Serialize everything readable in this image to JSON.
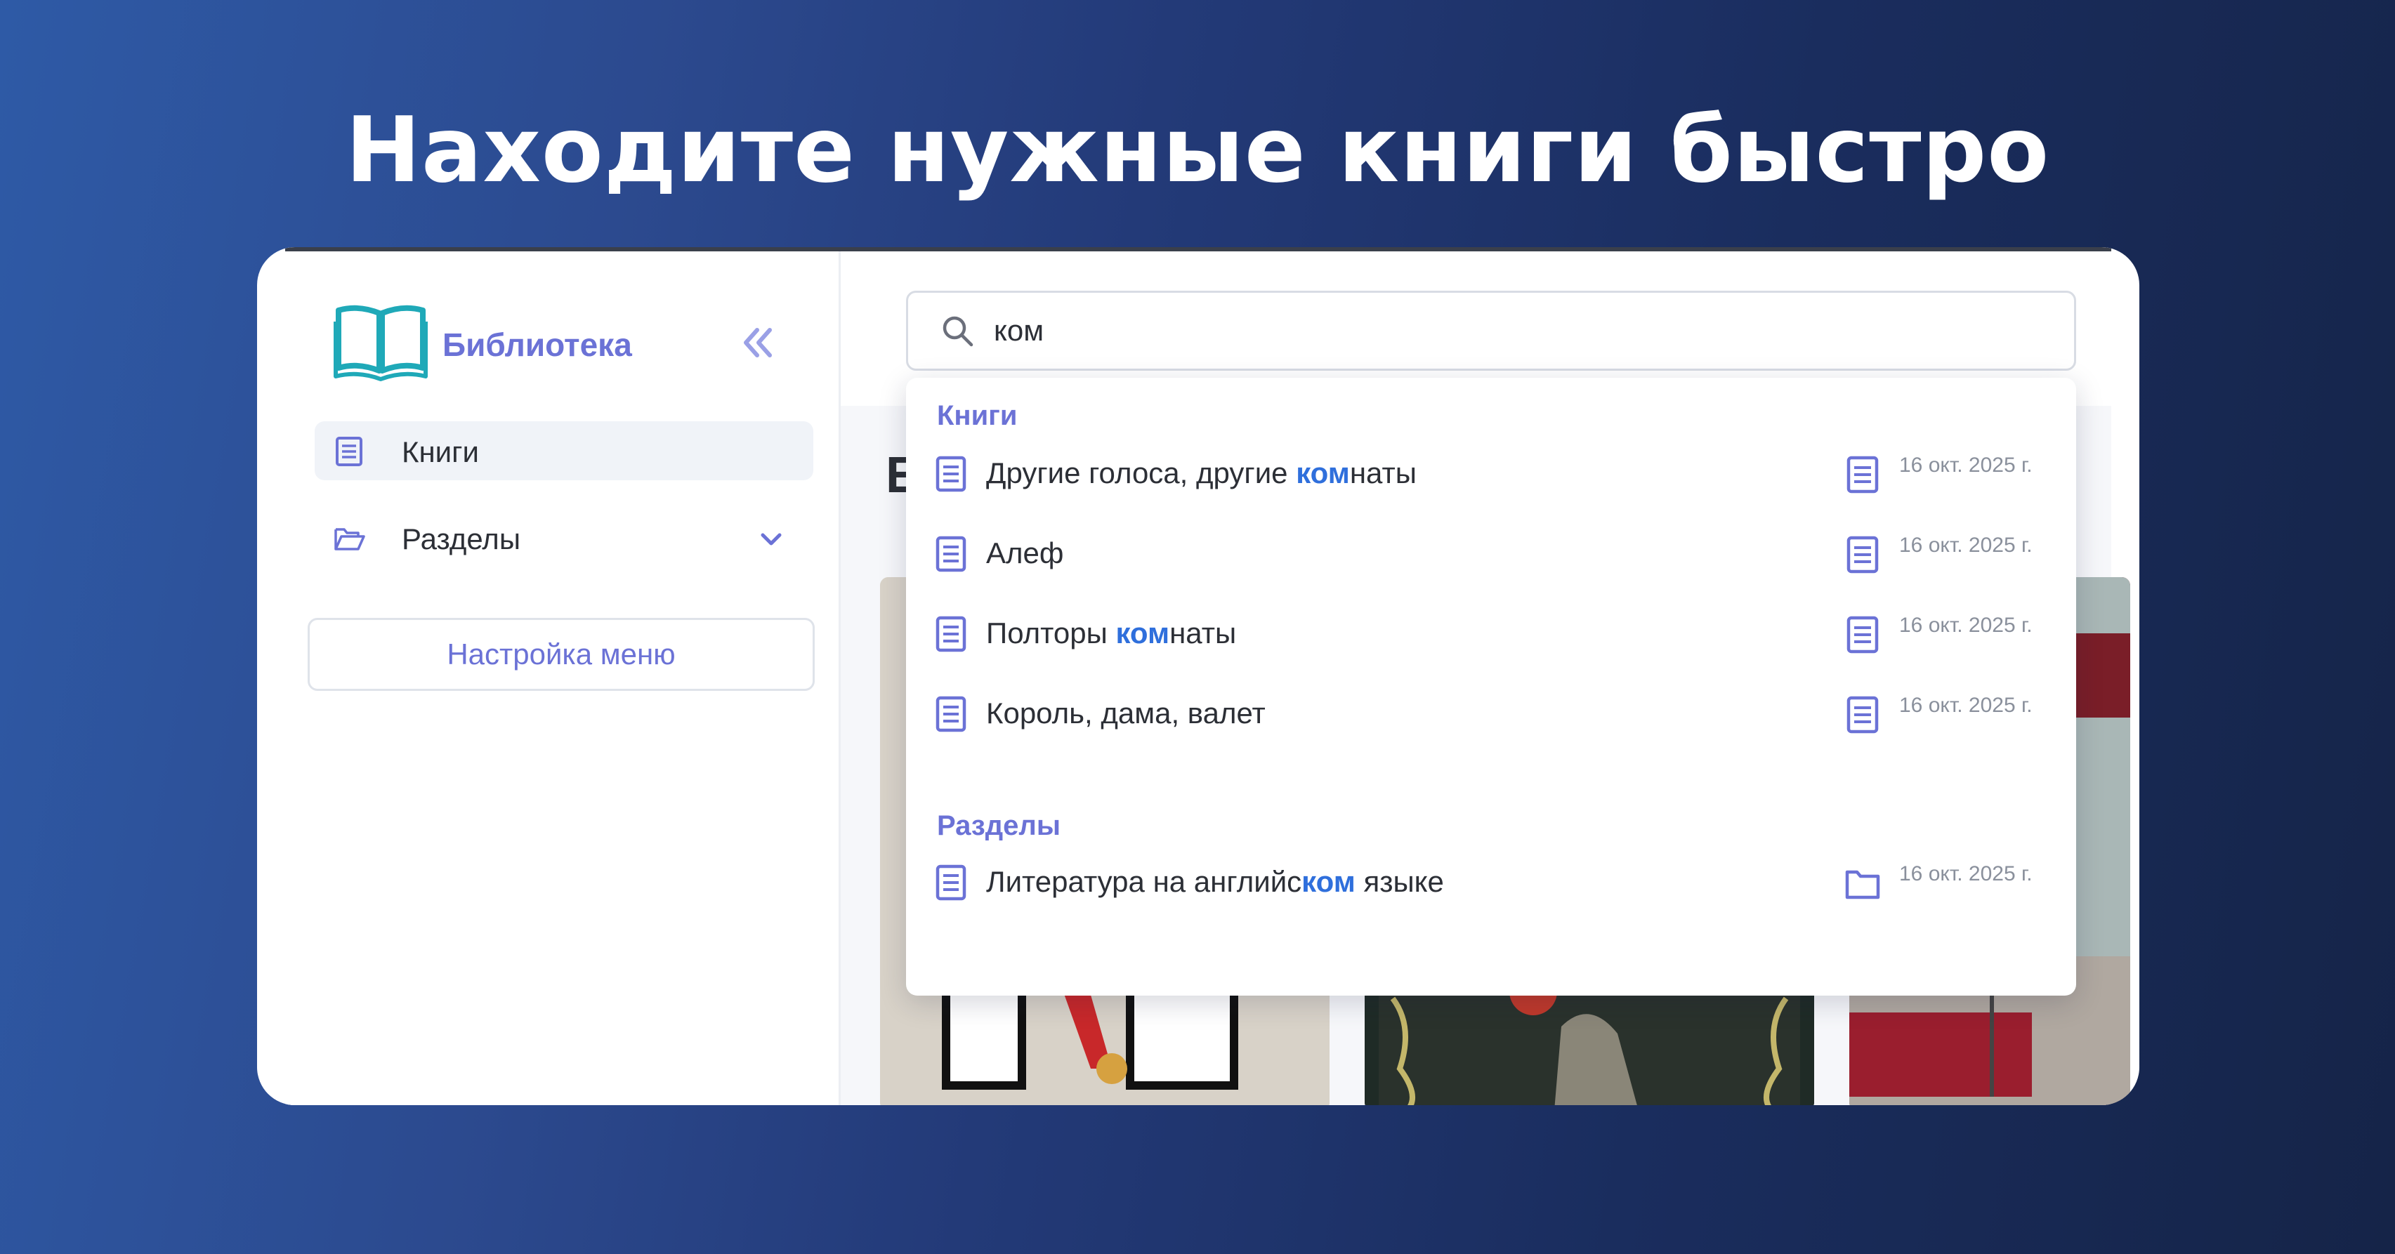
{
  "headline": "Находите нужные книги быстро",
  "app": {
    "logo_text": "Библиотека",
    "nav": [
      {
        "label": "Книги",
        "icon": "book-icon",
        "active": true
      },
      {
        "label": "Разделы",
        "icon": "folder-open-icon",
        "expandable": true
      }
    ],
    "menu_settings_label": "Настройка меню",
    "partial_heading": "Е"
  },
  "search": {
    "value": "ком",
    "placeholder": ""
  },
  "results": {
    "groups": [
      {
        "title": "Книги",
        "items": [
          {
            "pre": "Другие голоса, другие ",
            "hl": "ком",
            "post": "наты",
            "date": "16 окт. 2025 г.",
            "type_icon": "book-icon"
          },
          {
            "pre": "Алеф",
            "hl": "",
            "post": "",
            "date": "16 окт. 2025 г.",
            "type_icon": "book-icon"
          },
          {
            "pre": "Полторы ",
            "hl": "ком",
            "post": "наты",
            "date": "16 окт. 2025 г.",
            "type_icon": "book-icon"
          },
          {
            "pre": "Король, дама, валет",
            "hl": "",
            "post": "",
            "date": "16 окт. 2025 г.",
            "type_icon": "book-icon"
          }
        ]
      },
      {
        "title": "Разделы",
        "items": [
          {
            "pre": "Литература на английс",
            "hl": "ком",
            "post": " языке",
            "date": "16 окт. 2025 г.",
            "type_icon": "folder-icon"
          }
        ]
      }
    ]
  },
  "colors": {
    "accent": "#6b72d6",
    "highlight": "#2f6fdc",
    "logo": "#1fa9b8"
  }
}
